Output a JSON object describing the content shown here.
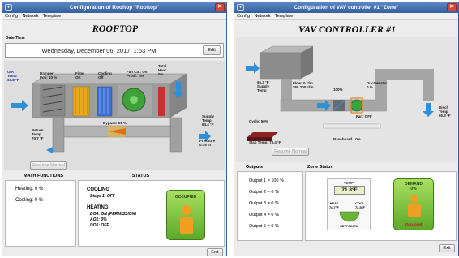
{
  "rooftop": {
    "window_title": "Configuration of Rooftop \"Rooftop\"",
    "menu": [
      "Config",
      "Network",
      "Template"
    ],
    "heading": "ROOFTOP",
    "datetime_label": "Date/Time",
    "datetime_value": "Wednesday, December 06, 2017, 1:53 PM",
    "edit_label": "Edit",
    "oa_temp": "O/A\nTemp\n60.8 °F",
    "damper": "Damper\nPos: 10 %",
    "filter": "Filter\nOK",
    "cooling": "Cooling\nOff",
    "fan": "Fan Cat: On\nProof: Yes",
    "total_heat": "Total\nHeat\n0%",
    "return_temp": "Return\nTemp\n70.7 °F",
    "bypass": "Bypass: 50 %",
    "supply_temp": "Supply\nTemp\n64.4 °F",
    "pressure": "Pressure\n0.75 in",
    "resume_label": "Resume Normal",
    "math_header": "MATH FUNCTIONS",
    "status_header": "STATUS",
    "heating_pct": "Heating: 0 %",
    "cooling_pct": "Cooling: 0 %",
    "cooling_title": "COOLING",
    "cooling_stage": "Stage 1: OFF",
    "heating_title": "HEATING",
    "do4": "DO4: ON (PERMISSION)",
    "ao1": "AO1: 0%",
    "do5": "DO5: OFF",
    "occupied_label": "OCCUPIED",
    "exit_label": "Exit"
  },
  "vav": {
    "window_title": "Configuration of VAV controller #1 \"Zone\"",
    "menu": [
      "Config",
      "Network",
      "Template"
    ],
    "heading": "VAV CONTROLLER #1",
    "supply_temp": "65.3 °F\nSupply\nTemp",
    "flow": "Flow: 0 cfm\nSP: 200 cfm",
    "damper_pct": "100%",
    "duct_heater": "Duct Heater\n0 %",
    "fan": "Fan: OFF",
    "disch_temp": "Disch\nTemp\n65.3 °F",
    "cycle": "Cycle: 50%",
    "slab_temp": "Slab Temp: 73.4 °F",
    "baseboard": "Baseboard : 0%",
    "resume_label": "Resume Normal",
    "outputs_header": "Outputs",
    "zone_header": "Zone Status",
    "outputs": [
      "Output 1 = 100 %",
      "Output 2 = 0 %",
      "Output 3 = 0 %",
      "Output 4 = 0 %",
      "Output 5 = 0 %"
    ],
    "temp_label": "TEMP",
    "temp_value": "71.8°F",
    "heat_sp": "HEAT\n78.7°F",
    "cool_sp": "COOL\n72.5°F",
    "setpoints_label": "SETPOINTS",
    "demand_label": "DEMAND\n0%",
    "occupied_label": "Occupied",
    "exit_label": "Exit"
  },
  "colors": {
    "title_bar": "#34609f",
    "occupied_green": "#7cc13a",
    "close_red": "#d04a3b"
  }
}
